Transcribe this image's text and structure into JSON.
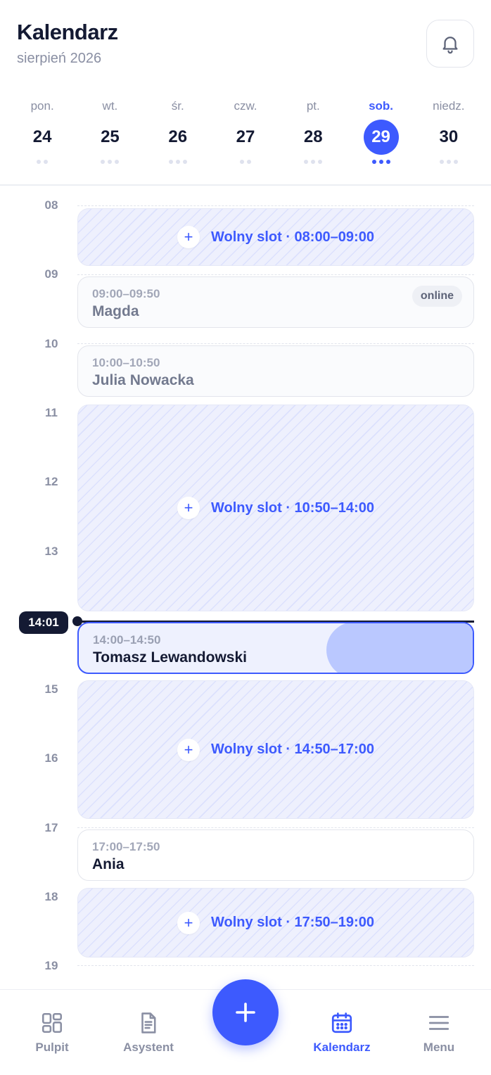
{
  "header": {
    "title": "Kalendarz",
    "subtitle": "sierpień 2026"
  },
  "week": {
    "days": [
      {
        "name": "pon.",
        "num": "24",
        "dots": 2,
        "active": false
      },
      {
        "name": "wt.",
        "num": "25",
        "dots": 3,
        "active": false
      },
      {
        "name": "śr.",
        "num": "26",
        "dots": 3,
        "active": false
      },
      {
        "name": "czw.",
        "num": "27",
        "dots": 2,
        "active": false
      },
      {
        "name": "pt.",
        "num": "28",
        "dots": 3,
        "active": false
      },
      {
        "name": "sob.",
        "num": "29",
        "dots": 3,
        "active": true
      },
      {
        "name": "niedz.",
        "num": "30",
        "dots": 3,
        "active": false
      }
    ]
  },
  "timeline": {
    "hours": [
      "08",
      "09",
      "10",
      "11",
      "12",
      "13",
      "14",
      "15",
      "16",
      "17",
      "18",
      "19"
    ],
    "free_slots": [
      {
        "label": "Wolny slot · 08:00–09:00"
      },
      {
        "label": "Wolny slot · 10:50–14:00"
      },
      {
        "label": "Wolny slot · 14:50–17:00"
      },
      {
        "label": "Wolny slot · 17:50–19:00"
      }
    ],
    "appointments": [
      {
        "time": "09:00–09:50",
        "name": "Magda",
        "badge": "online"
      },
      {
        "time": "10:00–10:50",
        "name": "Julia Nowacka"
      },
      {
        "time": "14:00–14:50",
        "name": "Tomasz Lewandowski"
      },
      {
        "time": "17:00–17:50",
        "name": "Ania"
      }
    ],
    "now": "14:01"
  },
  "bottom_nav": {
    "items": [
      {
        "label": "Pulpit",
        "icon": "grid-icon"
      },
      {
        "label": "Asystent",
        "icon": "document-icon"
      },
      {
        "label": "Kalendarz",
        "icon": "calendar-icon",
        "active": true
      },
      {
        "label": "Menu",
        "icon": "menu-icon"
      }
    ],
    "fab_icon": "plus-icon"
  },
  "colors": {
    "accent": "#3d5afe",
    "dark": "#141a33",
    "muted": "#8a8fa3"
  }
}
